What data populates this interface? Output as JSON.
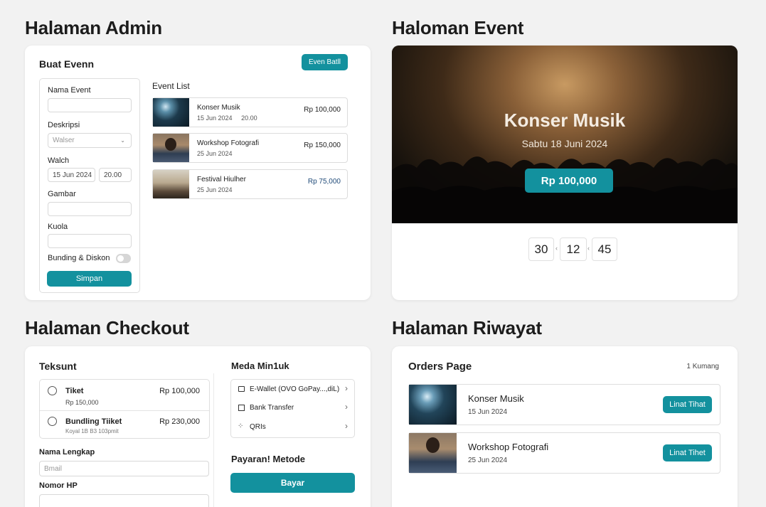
{
  "colors": {
    "accent": "#13919e",
    "background": "#f2f2f2",
    "card": "#ffffff"
  },
  "admin": {
    "section_title": "Halaman Admin",
    "card_title": "Buat Evenn",
    "new_button": "Even Batll",
    "form": {
      "name_label": "Nama Event",
      "name_value": "",
      "desc_label": "Deskripsi",
      "desc_select": "Walser",
      "time_label": "Walch",
      "date_value": "15 Jun 2024",
      "time_value": "20.00",
      "image_label": "Gambar",
      "quota_label": "Kuola",
      "bundle_label": "Bunding & Diskon",
      "bundle_toggle": false,
      "save_button": "Simpan"
    },
    "event_list_title": "Event List",
    "events": [
      {
        "name": "Konser Musik",
        "date": "15 Jun 2024",
        "time": "20.00",
        "price": "Rp 100,000",
        "thumb": "concert-thumbnail"
      },
      {
        "name": "Workshop Fotografi",
        "date": "25 Jun 2024",
        "time": "",
        "price": "Rp 150,000",
        "thumb": "portrait-thumbnail"
      },
      {
        "name": "Festival Hiulher",
        "date": "25 Jun 2024",
        "time": "",
        "price": "Rp 75,000",
        "thumb": "festival-thumbnail"
      }
    ]
  },
  "event": {
    "section_title": "Haloman Event",
    "hero_title": "Konser Musik",
    "hero_date": "Sabtu  18 Juni 2024",
    "price_button": "Rp 100,000",
    "countdown": [
      "30",
      "12",
      "45"
    ],
    "separator": "‹"
  },
  "checkout": {
    "section_title": "Halaman Checkout",
    "tickets_title": "Teksunt",
    "tickets": [
      {
        "name": "Tiket",
        "price": "Rp 100,000",
        "sub": "Rp 150,000"
      },
      {
        "name": "Bundling Tiiket",
        "price": "Rp 230,000",
        "sub": "Koyal 1B B3   103pmit"
      }
    ],
    "name_label": "Nama Lengkap",
    "name_placeholder": "Bmail",
    "phone_label": "Nomor HP",
    "payment_title": "Meda Min1uk",
    "payment_options": [
      {
        "label": "E-Wallet (OVO GoPay...,diL)",
        "icon": "wallet-icon"
      },
      {
        "label": "Bank Transfer",
        "icon": "bank-icon"
      },
      {
        "label": "QRIs",
        "icon": "qr-icon"
      }
    ],
    "method_title": "Payaran! Metode",
    "pay_button": "Bayar"
  },
  "history": {
    "section_title": "Halaman Riwayat",
    "card_title": "Orders Page",
    "count": "1 Kumang",
    "orders": [
      {
        "name": "Konser Musik",
        "date": "15 Jun 2024",
        "button": "Linat Tihat",
        "thumb": "concert-thumbnail"
      },
      {
        "name": "Workshop Fotografi",
        "date": "25 Jun 2024",
        "button": "Linat Tihet",
        "thumb": "portrait-thumbnail"
      }
    ]
  }
}
